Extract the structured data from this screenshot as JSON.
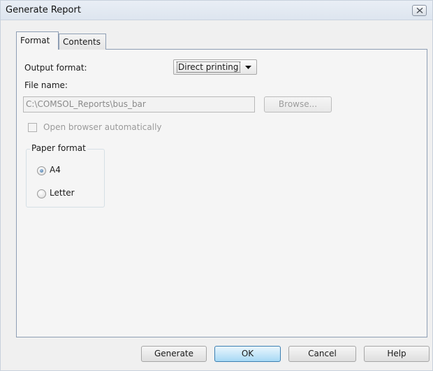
{
  "window": {
    "title": "Generate Report"
  },
  "tabs": [
    {
      "label": "Format",
      "active": true
    },
    {
      "label": "Contents",
      "active": false
    }
  ],
  "format": {
    "output_format_label": "Output format:",
    "output_format_value": "Direct printing",
    "file_name_label": "File name:",
    "file_name_value": "C:\\COMSOL_Reports\\bus_bar",
    "file_name_enabled": false,
    "browse_label": "Browse...",
    "browse_enabled": false,
    "open_browser_label": "Open browser automatically",
    "open_browser_checked": false,
    "open_browser_enabled": false,
    "paper_format": {
      "legend": "Paper format",
      "options": [
        {
          "label": "A4",
          "selected": true
        },
        {
          "label": "Letter",
          "selected": false
        }
      ]
    }
  },
  "buttons": {
    "generate": "Generate",
    "ok": "OK",
    "cancel": "Cancel",
    "help": "Help"
  },
  "colors": {
    "dialog_bg": "#f0f0f0",
    "titlebar": "#dde5ef",
    "tab_border": "#8e9eb4",
    "default_button": "#a7d9f5",
    "disabled_text": "#9a9a9a"
  }
}
